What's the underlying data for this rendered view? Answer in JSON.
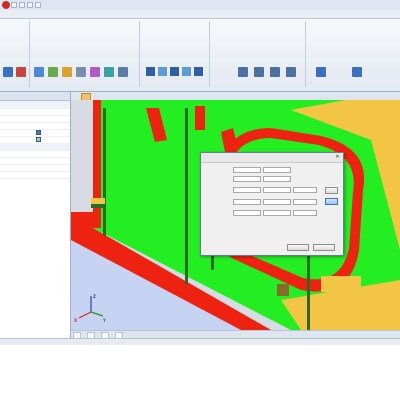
{
  "window": {
    "title": "",
    "menu_tabs": [
      "",
      "",
      "",
      "",
      "",
      "",
      "",
      ""
    ]
  },
  "ribbon": {
    "group_labels": [
      "",
      "",
      "",
      "",
      ""
    ]
  },
  "left_panel": {
    "header": "",
    "rows": [
      {
        "key": "",
        "value": ""
      },
      {
        "key": "",
        "value": ""
      },
      {
        "key": "",
        "value": ""
      },
      {
        "key": "",
        "value": ""
      },
      {
        "key": "",
        "value": ""
      },
      {
        "key": "",
        "value": ""
      },
      {
        "key": "",
        "value": ""
      },
      {
        "key": "",
        "value": ""
      },
      {
        "key": "",
        "value": ""
      },
      {
        "key": "",
        "value": ""
      },
      {
        "key": "",
        "value": ""
      }
    ]
  },
  "viewport": {
    "tab_label": "",
    "info_lines": [
      "",
      "",
      "",
      ""
    ],
    "bottom_tabs": [
      "",
      "",
      "",
      ""
    ]
  },
  "dialog": {
    "title": "",
    "close_glyph": "✕",
    "rows": [
      {
        "label": "",
        "v1": "",
        "v2": ""
      },
      {
        "label": "",
        "v1": "",
        "v2": ""
      },
      {
        "label": "",
        "v1": "",
        "v2": "",
        "v3": "",
        "v4": ""
      },
      {
        "label": "",
        "v1": "",
        "v2": "",
        "v3": "",
        "v4": ""
      },
      {
        "label": "",
        "v1": "",
        "v2": "",
        "v3": "",
        "v4": ""
      }
    ],
    "note": "",
    "side_button_1": "",
    "side_button_2": "",
    "ok_label": "",
    "cancel_label": ""
  },
  "axes": {
    "x": "X",
    "y": "Y",
    "z": "Z"
  },
  "colors": {
    "plate_green": "#22ee22",
    "edge_red": "#ee2211",
    "accent_blue": "#2a7ee8",
    "hull_yellow": "#f3c544"
  }
}
